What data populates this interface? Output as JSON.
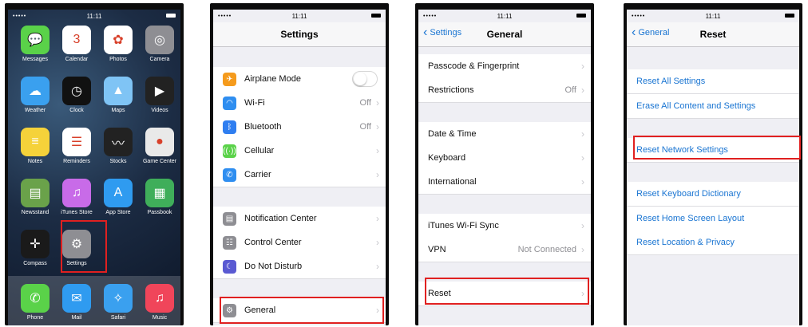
{
  "home": {
    "status": {
      "carrier": "•••••",
      "time": "11:11"
    },
    "apps": [
      {
        "name": "Messages",
        "icon": "messages-icon",
        "bg": "#5ad249",
        "glyph": "💬"
      },
      {
        "name": "Calendar",
        "icon": "calendar-icon",
        "bg": "#ffffff",
        "glyph": "3",
        "extra": "Tuesday"
      },
      {
        "name": "Photos",
        "icon": "photos-icon",
        "bg": "#ffffff",
        "glyph": "✿"
      },
      {
        "name": "Camera",
        "icon": "camera-icon",
        "bg": "#8e8e93",
        "glyph": "◎"
      },
      {
        "name": "Weather",
        "icon": "weather-icon",
        "bg": "#3aa0ef",
        "glyph": "☁"
      },
      {
        "name": "Clock",
        "icon": "clock-icon",
        "bg": "#111111",
        "glyph": "◷"
      },
      {
        "name": "Maps",
        "icon": "maps-icon",
        "bg": "#7fc4f5",
        "glyph": "▲"
      },
      {
        "name": "Videos",
        "icon": "videos-icon",
        "bg": "#222222",
        "glyph": "▶"
      },
      {
        "name": "Notes",
        "icon": "notes-icon",
        "bg": "#f5d23a",
        "glyph": "≡"
      },
      {
        "name": "Reminders",
        "icon": "reminders-icon",
        "bg": "#ffffff",
        "glyph": "☰"
      },
      {
        "name": "Stocks",
        "icon": "stocks-icon",
        "bg": "#222222",
        "glyph": "〰"
      },
      {
        "name": "Game Center",
        "icon": "game-center-icon",
        "bg": "#e9e9e9",
        "glyph": "●"
      },
      {
        "name": "Newsstand",
        "icon": "newsstand-icon",
        "bg": "#6aa24a",
        "glyph": "▤"
      },
      {
        "name": "iTunes Store",
        "icon": "itunes-store-icon",
        "bg": "#c86be8",
        "glyph": "♫"
      },
      {
        "name": "App Store",
        "icon": "app-store-icon",
        "bg": "#2f9bf0",
        "glyph": "A"
      },
      {
        "name": "Passbook",
        "icon": "passbook-icon",
        "bg": "#3fae5a",
        "glyph": "▦"
      },
      {
        "name": "Compass",
        "icon": "compass-icon",
        "bg": "#1a1a1a",
        "glyph": "✛"
      },
      {
        "name": "Settings",
        "icon": "settings-gear-icon",
        "bg": "#8e8e93",
        "glyph": "⚙"
      }
    ],
    "dock": [
      {
        "name": "Phone",
        "icon": "phone-icon",
        "bg": "#5ad249",
        "glyph": "✆"
      },
      {
        "name": "Mail",
        "icon": "mail-icon",
        "bg": "#2f9bf0",
        "glyph": "✉"
      },
      {
        "name": "Safari",
        "icon": "safari-icon",
        "bg": "#3aa0ef",
        "glyph": "✧"
      },
      {
        "name": "Music",
        "icon": "music-icon",
        "bg": "#f0455a",
        "glyph": "♫"
      }
    ]
  },
  "settings": {
    "status": {
      "carrier": "•••••",
      "time": "11:11"
    },
    "title": "Settings",
    "rows": [
      {
        "label": "Airplane Mode",
        "icon": "airplane-icon",
        "bg": "#f59b1d",
        "glyph": "✈",
        "toggle": true
      },
      {
        "label": "Wi-Fi",
        "icon": "wifi-icon",
        "bg": "#2f8ef0",
        "glyph": "◠",
        "value": "Off"
      },
      {
        "label": "Bluetooth",
        "icon": "bluetooth-icon",
        "bg": "#2f7ef0",
        "glyph": "ᛒ",
        "value": "Off"
      },
      {
        "label": "Cellular",
        "icon": "cellular-icon",
        "bg": "#5ad249",
        "glyph": "((·))",
        "value": ""
      },
      {
        "label": "Carrier",
        "icon": "carrier-phone-icon",
        "bg": "#2f8ef0",
        "glyph": "✆",
        "value": ""
      },
      {
        "label": "Notification Center",
        "icon": "notification-center-icon",
        "bg": "#8e8e93",
        "glyph": "▤",
        "value": ""
      },
      {
        "label": "Control Center",
        "icon": "control-center-icon",
        "bg": "#8e8e93",
        "glyph": "☷",
        "value": ""
      },
      {
        "label": "Do Not Disturb",
        "icon": "moon-icon",
        "bg": "#5a5ad2",
        "glyph": "☾",
        "value": ""
      },
      {
        "label": "General",
        "icon": "general-gear-icon",
        "bg": "#8e8e93",
        "glyph": "⚙",
        "value": ""
      }
    ]
  },
  "general": {
    "status": {
      "carrier": "•••••",
      "time": "11:11"
    },
    "back": "Settings",
    "title": "General",
    "rows": [
      {
        "label": "Passcode & Fingerprint",
        "value": ""
      },
      {
        "label": "Restrictions",
        "value": "Off"
      },
      {
        "label": "Date & Time",
        "value": ""
      },
      {
        "label": "Keyboard",
        "value": ""
      },
      {
        "label": "International",
        "value": ""
      },
      {
        "label": "iTunes Wi-Fi Sync",
        "value": ""
      },
      {
        "label": "VPN",
        "value": "Not Connected"
      },
      {
        "label": "Reset",
        "value": ""
      }
    ]
  },
  "reset": {
    "status": {
      "carrier": "•••••",
      "time": "11:11"
    },
    "back": "General",
    "title": "Reset",
    "rows": [
      {
        "label": "Reset All Settings"
      },
      {
        "label": "Erase All Content and Settings"
      },
      {
        "label": "Reset Network Settings"
      },
      {
        "label": "Reset Keyboard Dictionary"
      },
      {
        "label": "Reset Home Screen Layout"
      },
      {
        "label": "Reset Location & Privacy"
      }
    ]
  },
  "colors": {
    "accent": "#1a75d2",
    "highlight": "#e02020"
  }
}
